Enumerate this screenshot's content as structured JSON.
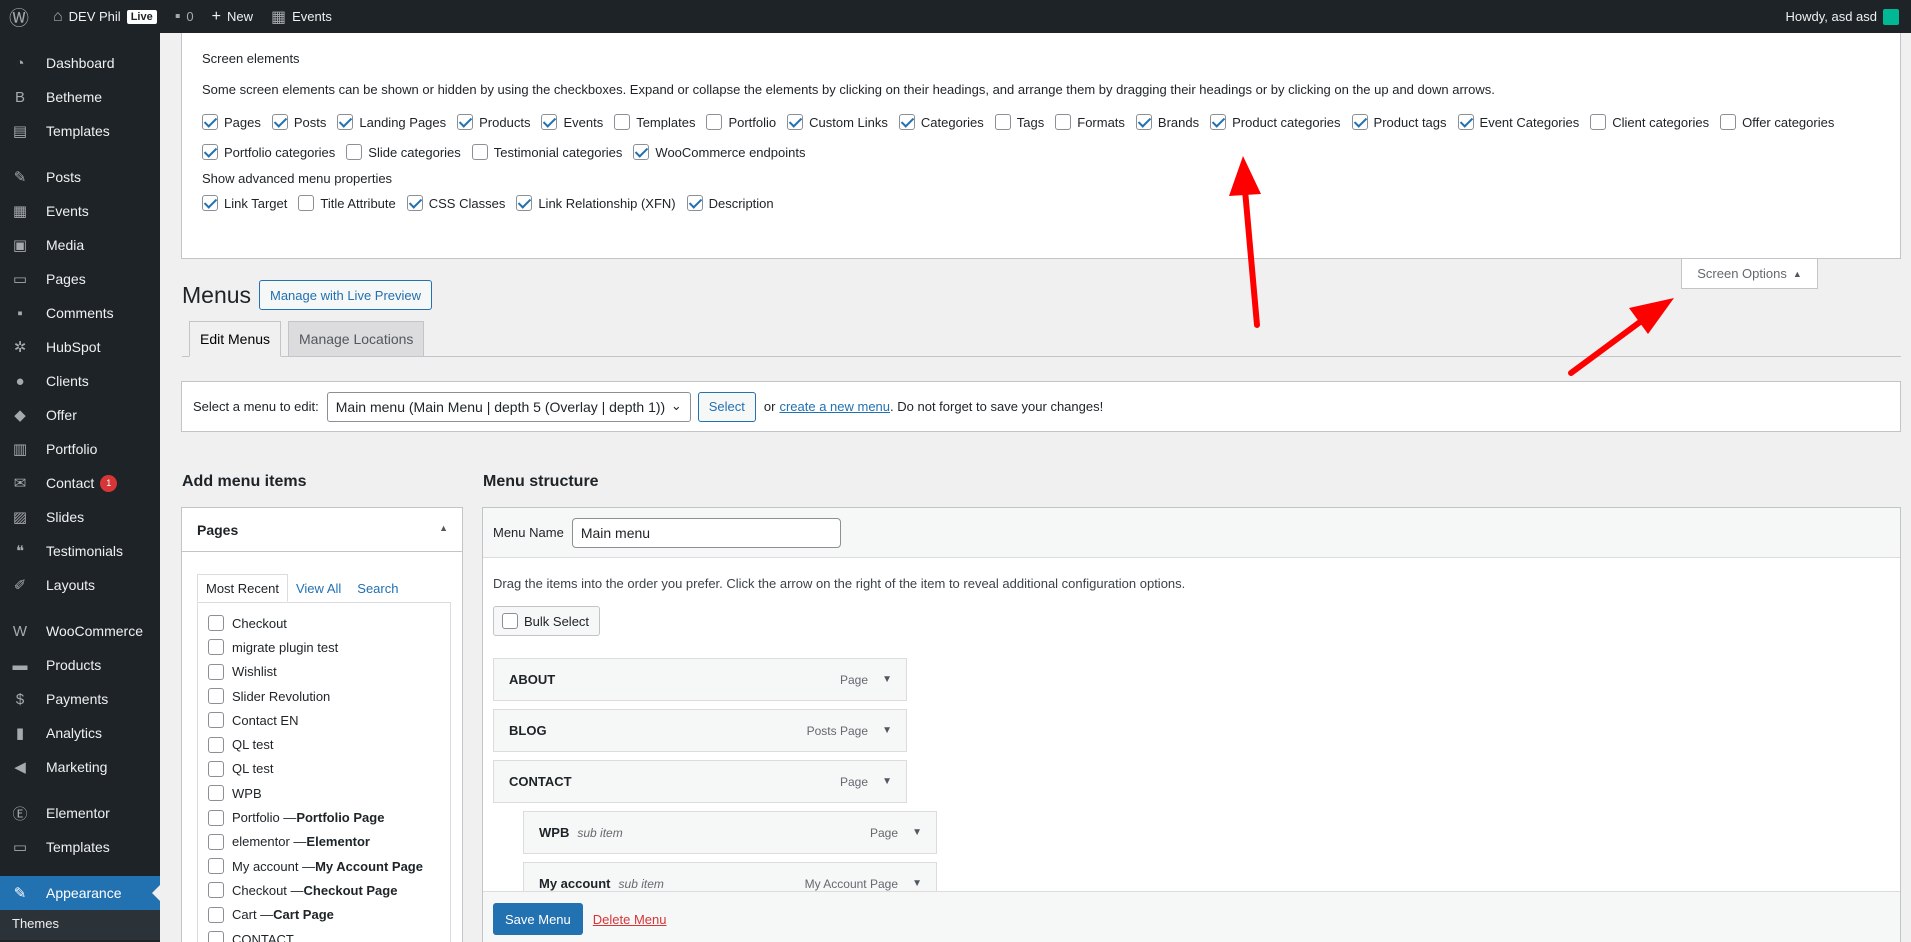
{
  "adminbar": {
    "site_name": "DEV Phil",
    "live_badge": "Live",
    "comments_count": "0",
    "new_label": "New",
    "events_label": "Events",
    "howdy": "Howdy, asd asd"
  },
  "sidebar": {
    "items": [
      {
        "label": "Dashboard",
        "icon": "dashboard-icon"
      },
      {
        "label": "Betheme",
        "icon": "betheme-icon"
      },
      {
        "label": "Templates",
        "icon": "templates-icon"
      },
      {
        "label": "Posts",
        "icon": "pin-icon"
      },
      {
        "label": "Events",
        "icon": "calendar-icon"
      },
      {
        "label": "Media",
        "icon": "media-icon"
      },
      {
        "label": "Pages",
        "icon": "pages-icon"
      },
      {
        "label": "Comments",
        "icon": "comment-icon"
      },
      {
        "label": "HubSpot",
        "icon": "hubspot-icon"
      },
      {
        "label": "Clients",
        "icon": "user-icon"
      },
      {
        "label": "Offer",
        "icon": "tag-icon"
      },
      {
        "label": "Portfolio",
        "icon": "portfolio-icon"
      },
      {
        "label": "Contact",
        "icon": "mail-icon",
        "badge": "1"
      },
      {
        "label": "Slides",
        "icon": "slides-icon"
      },
      {
        "label": "Testimonials",
        "icon": "quote-icon"
      },
      {
        "label": "Layouts",
        "icon": "edit-icon"
      },
      {
        "label": "WooCommerce",
        "icon": "woo-icon"
      },
      {
        "label": "Products",
        "icon": "archive-icon"
      },
      {
        "label": "Payments",
        "icon": "payment-icon"
      },
      {
        "label": "Analytics",
        "icon": "chart-icon"
      },
      {
        "label": "Marketing",
        "icon": "megaphone-icon"
      },
      {
        "label": "Elementor",
        "icon": "elementor-icon"
      },
      {
        "label": "Templates",
        "icon": "folder-icon"
      },
      {
        "label": "Appearance",
        "icon": "brush-icon"
      }
    ],
    "submenu_themes": "Themes"
  },
  "screen_options": {
    "heading": "Screen elements",
    "description": "Some screen elements can be shown or hidden by using the checkboxes. Expand or collapse the elements by clicking on their headings, and arrange them by dragging their headings or by clicking on the up and down arrows.",
    "elements": [
      {
        "label": "Pages",
        "checked": true
      },
      {
        "label": "Posts",
        "checked": true
      },
      {
        "label": "Landing Pages",
        "checked": true
      },
      {
        "label": "Products",
        "checked": true
      },
      {
        "label": "Events",
        "checked": true
      },
      {
        "label": "Templates",
        "checked": false
      },
      {
        "label": "Portfolio",
        "checked": false
      },
      {
        "label": "Custom Links",
        "checked": true
      },
      {
        "label": "Categories",
        "checked": true
      },
      {
        "label": "Tags",
        "checked": false
      },
      {
        "label": "Formats",
        "checked": false
      },
      {
        "label": "Brands",
        "checked": true
      },
      {
        "label": "Product categories",
        "checked": true
      },
      {
        "label": "Product tags",
        "checked": true
      },
      {
        "label": "Event Categories",
        "checked": true
      },
      {
        "label": "Client categories",
        "checked": false
      },
      {
        "label": "Offer categories",
        "checked": false
      },
      {
        "label": "Portfolio categories",
        "checked": true
      },
      {
        "label": "Slide categories",
        "checked": false
      },
      {
        "label": "Testimonial categories",
        "checked": false
      },
      {
        "label": "WooCommerce endpoints",
        "checked": true
      }
    ],
    "advanced_heading": "Show advanced menu properties",
    "advanced": [
      {
        "label": "Link Target",
        "checked": true
      },
      {
        "label": "Title Attribute",
        "checked": false
      },
      {
        "label": "CSS Classes",
        "checked": true
      },
      {
        "label": "Link Relationship (XFN)",
        "checked": true
      },
      {
        "label": "Description",
        "checked": true
      }
    ],
    "toggle_label": "Screen Options"
  },
  "page": {
    "title": "Menus",
    "live_preview_button": "Manage with Live Preview",
    "tabs": [
      "Edit Menus",
      "Manage Locations"
    ]
  },
  "manage": {
    "select_label": "Select a menu to edit:",
    "selected_menu": "Main menu (Main Menu | depth 5 (Overlay | depth 1))",
    "select_button": "Select",
    "or_text": "or",
    "create_link": "create a new menu",
    "after_text": ". Do not forget to save your changes!"
  },
  "add_items": {
    "title": "Add menu items",
    "box_title": "Pages",
    "tabs": [
      "Most Recent",
      "View All",
      "Search"
    ],
    "pages": [
      {
        "name": "Checkout",
        "suffix": ""
      },
      {
        "name": "migrate plugin test",
        "suffix": ""
      },
      {
        "name": "Wishlist",
        "suffix": ""
      },
      {
        "name": "Slider Revolution",
        "suffix": ""
      },
      {
        "name": "Contact EN",
        "suffix": ""
      },
      {
        "name": "QL test",
        "suffix": ""
      },
      {
        "name": "QL test",
        "suffix": ""
      },
      {
        "name": "WPB",
        "suffix": ""
      },
      {
        "name": "Portfolio — ",
        "suffix": "Portfolio Page"
      },
      {
        "name": "elementor — ",
        "suffix": "Elementor"
      },
      {
        "name": "My account — ",
        "suffix": "My Account Page"
      },
      {
        "name": "Checkout — ",
        "suffix": "Checkout Page"
      },
      {
        "name": "Cart — ",
        "suffix": "Cart Page"
      },
      {
        "name": "CONTACT",
        "suffix": ""
      }
    ]
  },
  "structure": {
    "title": "Menu structure",
    "menu_name_label": "Menu Name",
    "menu_name_value": "Main menu",
    "drag_note": "Drag the items into the order you prefer. Click the arrow on the right of the item to reveal additional configuration options.",
    "bulk_select": "Bulk Select",
    "items": [
      {
        "title": "ABOUT",
        "sub": "",
        "type": "Page"
      },
      {
        "title": "BLOG",
        "sub": "",
        "type": "Posts Page"
      },
      {
        "title": "CONTACT",
        "sub": "",
        "type": "Page"
      },
      {
        "title": "WPB",
        "sub": "sub item",
        "type": "Page"
      },
      {
        "title": "My account",
        "sub": "sub item",
        "type": "My Account Page"
      }
    ],
    "save_button": "Save Menu",
    "delete_link": "Delete Menu"
  },
  "colors": {
    "admin_dark": "#1d2327",
    "accent": "#2271b1",
    "annotation_red": "#ff0000"
  }
}
